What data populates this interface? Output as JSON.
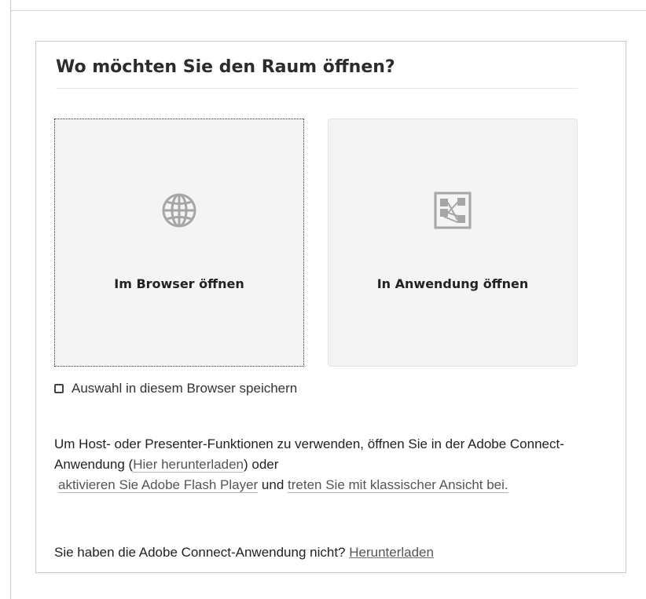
{
  "dialog": {
    "title": "Wo möchten Sie den Raum öffnen?",
    "options": [
      {
        "label": "Im Browser öffnen",
        "icon": "globe-icon"
      },
      {
        "label": "In Anwendung öffnen",
        "icon": "app-icon"
      }
    ],
    "remember_label": "Auswahl in diesem Browser speichern",
    "remember_checked": false
  },
  "info": {
    "part1": "Um Host- oder Presenter-Funktionen zu verwenden, öffnen Sie in der Adobe Connect-Anwendung (",
    "download_link": "Hier herunterladen",
    "part2": ") oder",
    "flash_link": "aktivieren Sie Adobe Flash Player",
    "part3": " und ",
    "classic_link": "treten Sie mit klassischer Ansicht bei."
  },
  "footer": {
    "question": "Sie haben die Adobe Connect-Anwendung nicht? ",
    "download_label": "Herunterladen"
  },
  "colors": {
    "card_bg": "#f4f4f4",
    "icon_gray": "#a6a6a6",
    "border": "#c9c9c9"
  }
}
